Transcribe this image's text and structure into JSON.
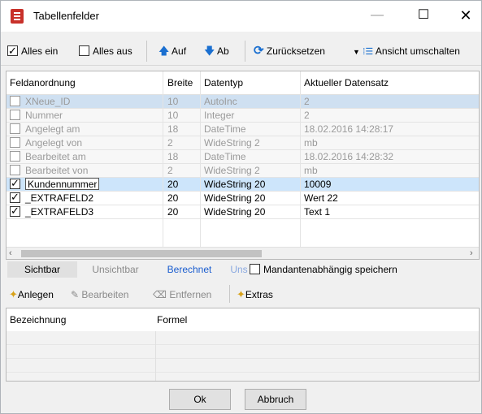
{
  "window": {
    "title": "Tabellenfelder"
  },
  "toolbar": {
    "alles_ein": "Alles ein",
    "alles_aus": "Alles aus",
    "auf": "Auf",
    "ab": "Ab",
    "zuruecksetzen": "Zurücksetzen",
    "ansicht": "Ansicht umschalten"
  },
  "grid": {
    "headers": [
      "Feldanordnung",
      "Breite",
      "Datentyp",
      "Aktueller Datensatz"
    ],
    "rows": [
      {
        "name": "XNeue_ID",
        "width": "10",
        "type": "AutoInc",
        "value": "2",
        "checked": false,
        "state": "disabled-selected"
      },
      {
        "name": "Nummer",
        "width": "10",
        "type": "Integer",
        "value": "2",
        "checked": false,
        "state": "disabled"
      },
      {
        "name": "Angelegt am",
        "width": "18",
        "type": "DateTime",
        "value": "18.02.2016 14:28:17",
        "checked": false,
        "state": "disabled"
      },
      {
        "name": "Angelegt von",
        "width": "2",
        "type": "WideString 2",
        "value": "mb",
        "checked": false,
        "state": "disabled"
      },
      {
        "name": "Bearbeitet am",
        "width": "18",
        "type": "DateTime",
        "value": "18.02.2016 14:28:32",
        "checked": false,
        "state": "disabled"
      },
      {
        "name": "Bearbeitet von",
        "width": "2",
        "type": "WideString 2",
        "value": "mb",
        "checked": false,
        "state": "disabled"
      },
      {
        "name": "Kundennummer",
        "width": "20",
        "type": "WideString 20",
        "value": "10009",
        "checked": true,
        "state": "selected"
      },
      {
        "name": "_EXTRAFELD2",
        "width": "20",
        "type": "WideString 20",
        "value": "Wert 22",
        "checked": true,
        "state": "active"
      },
      {
        "name": "_EXTRAFELD3",
        "width": "20",
        "type": "WideString 20",
        "value": "Text 1",
        "checked": true,
        "state": "active"
      }
    ]
  },
  "tabs": {
    "sichtbar": "Sichtbar",
    "unsichtbar": "Unsichtbar",
    "berechnet": "Berechnet",
    "uns": "Uns",
    "mandanten": "Mandantenabhängig speichern"
  },
  "lower_toolbar": {
    "anlegen": "Anlegen",
    "bearbeiten": "Bearbeiten",
    "entfernen": "Entfernen",
    "extras": "Extras"
  },
  "formula_grid": {
    "headers": [
      "Bezeichnung",
      "Formel"
    ]
  },
  "buttons": {
    "ok": "Ok",
    "abbruch": "Abbruch"
  },
  "colors": {
    "accent": "#1a6fd0",
    "selection": "#cde5fb",
    "app_icon": "#c8312a"
  }
}
